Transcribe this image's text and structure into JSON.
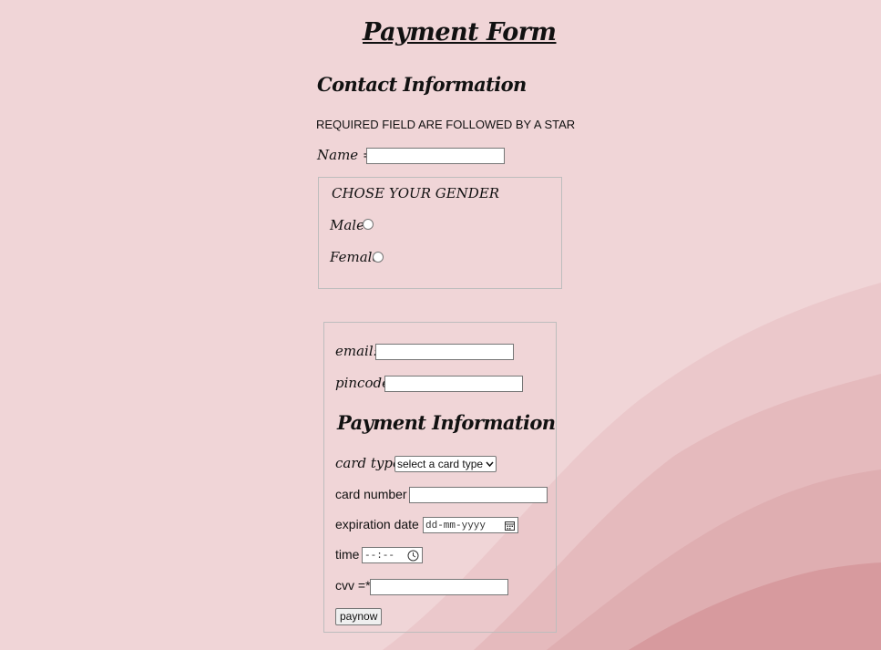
{
  "form": {
    "title": "Payment Form",
    "contact_heading": "Contact Information",
    "required_note": "REQUIRED FIELD ARE FOLLOWED BY A STAR",
    "name_label": "Name =",
    "star": "*",
    "gender": {
      "legend": "CHOSE YOUR GENDER",
      "male_label": "Male",
      "female_label": "Female"
    },
    "email_label": "email:",
    "pincode_label": "pincode=",
    "payment_heading": "Payment Information",
    "card_type_label": "card type=",
    "card_type_selected": "select a card type",
    "card_number_label": "card number",
    "expiration_label": "expiration date",
    "expiration_placeholder": "dd-mm-yyyy",
    "time_label": "time",
    "time_placeholder": "--:--",
    "cvv_label": "cvv =",
    "paynow_label": "paynow"
  },
  "icons": {
    "calendar": "calendar-icon",
    "clock": "clock-icon",
    "select_arrow": "chevron-down-icon"
  },
  "colors": {
    "background": "#f0d5d7",
    "wave_dark": "#d79a9e",
    "border": "#bdbdbd"
  }
}
